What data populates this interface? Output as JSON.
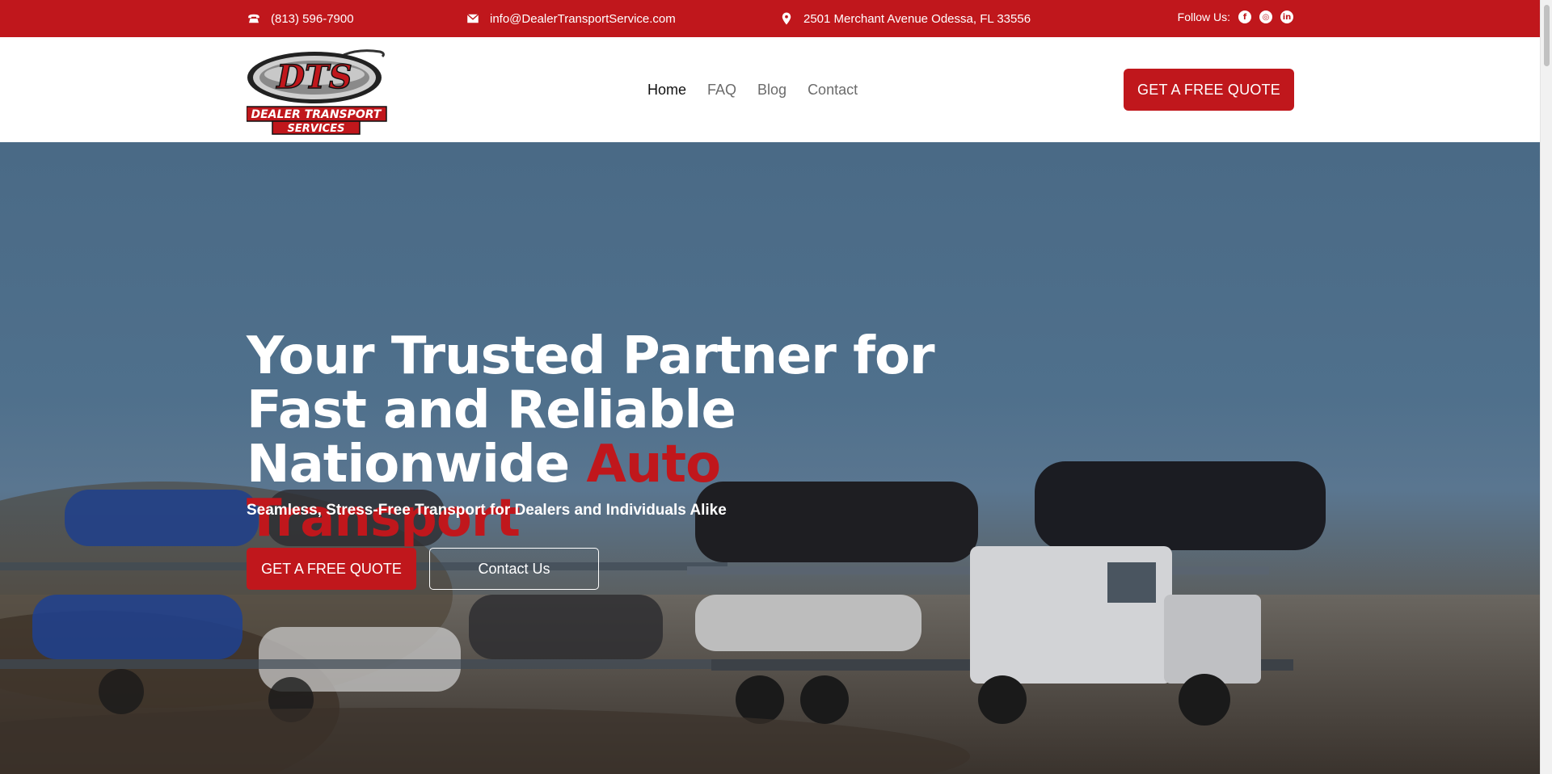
{
  "topbar": {
    "phone": "(813) 596-7900",
    "email": "info@DealerTransportService.com",
    "address": "2501 Merchant Avenue Odessa, FL 33556",
    "follow_label": "Follow Us:",
    "social": [
      "facebook-icon",
      "instagram-icon",
      "linkedin-icon"
    ]
  },
  "header": {
    "logo_text_top": "DTS",
    "logo_text_line1": "DEALER TRANSPORT",
    "logo_text_line2": "SERVICES",
    "nav": [
      "Home",
      "FAQ",
      "Blog",
      "Contact"
    ],
    "active_nav": "Home",
    "cta": "GET A FREE QUOTE"
  },
  "hero": {
    "title_line1": "Your Trusted Partner for",
    "title_line2": "Fast and Reliable",
    "title_line3_plain": "Nationwide ",
    "title_line3_accent": "Auto Transport",
    "subtitle": "Seamless, Stress-Free Transport for Dealers and Individuals Alike",
    "primary_button": "GET A FREE QUOTE",
    "secondary_button": "Contact Us"
  },
  "colors": {
    "brand_red": "#c0171c",
    "sky": "#4f708c",
    "white": "#ffffff"
  }
}
